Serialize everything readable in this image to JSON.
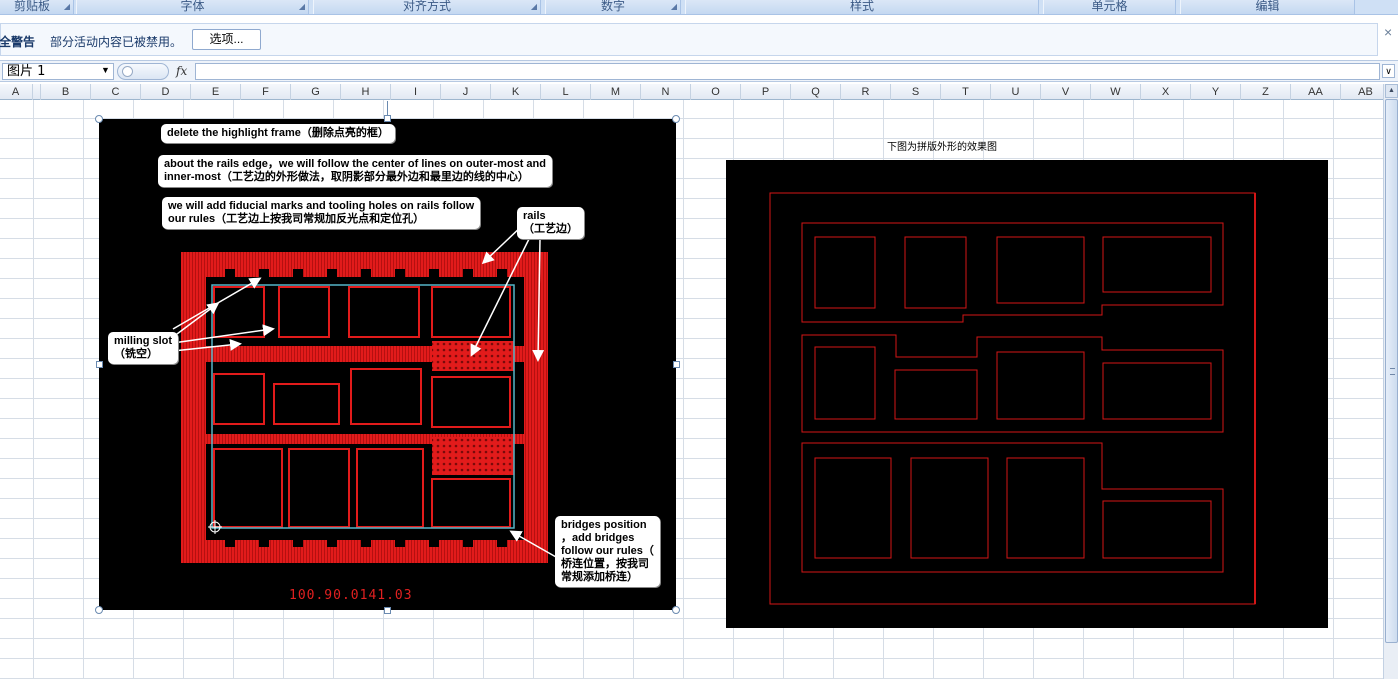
{
  "ribbon": {
    "groups": [
      {
        "label": "剪贴板"
      },
      {
        "label": "字体"
      },
      {
        "label": "对齐方式"
      },
      {
        "label": "数字"
      },
      {
        "label": "样式"
      },
      {
        "label": "单元格"
      },
      {
        "label": "编辑"
      }
    ]
  },
  "security_bar": {
    "title": "安全警告",
    "message": "部分活动内容已被禁用。",
    "options_button": "选项...",
    "close_glyph": "×"
  },
  "formula_bar": {
    "name_box_value": "图片 1",
    "fx_label": "fx",
    "formula_value": ""
  },
  "columns": [
    "A",
    "B",
    "C",
    "D",
    "E",
    "F",
    "G",
    "H",
    "I",
    "J",
    "K",
    "L",
    "M",
    "N",
    "O",
    "P",
    "Q",
    "R",
    "S",
    "T",
    "U",
    "V",
    "W",
    "X",
    "Y",
    "Z",
    "AA",
    "AB"
  ],
  "picture_left": {
    "callouts": {
      "highlight": "delete the highlight frame（删除点亮的框）",
      "rails_edge": "about the rails edge，we will follow the center of lines on outer-most and\ninner-most（工艺边的外形做法，取阴影部分最外边和最里边的线的中心）",
      "fiducial": "we will add fiducial marks and tooling holes on rails follow\nour rules（工艺边上按我司常规加反光点和定位孔）",
      "rails": "rails\n（工艺边）",
      "milling": "milling slot\n（铣空）",
      "bridges": "bridges position\n，add bridges\nfollow our rules（\n桥连位置，按我司\n常规添加桥连）"
    },
    "panel_id": "100.90.0141.03"
  },
  "picture_right": {
    "caption": "下图为拼版外形的效果图"
  },
  "colors": {
    "pcb_red": "#e21b1b",
    "outline_red": "#d31616",
    "selection_frame": "#56b5c7",
    "background": "#000000"
  },
  "icons": {
    "close": "close-icon",
    "fx": "function-icon",
    "dropdown": "chevron-down-icon",
    "scroll_up": "scroll-up-icon"
  }
}
